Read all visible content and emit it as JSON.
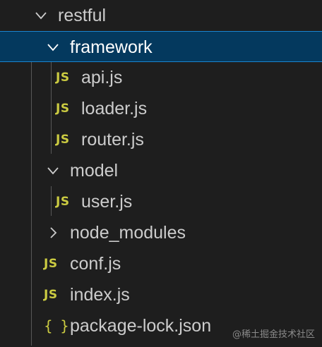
{
  "tree": {
    "root": {
      "label": "restful",
      "icon": "chevron-down-icon"
    },
    "framework": {
      "label": "framework",
      "icon": "chevron-down-icon"
    },
    "framework_files": [
      {
        "label": "api.js",
        "badge": "JS"
      },
      {
        "label": "loader.js",
        "badge": "JS"
      },
      {
        "label": "router.js",
        "badge": "JS"
      }
    ],
    "model": {
      "label": "model",
      "icon": "chevron-down-icon"
    },
    "model_files": [
      {
        "label": "user.js",
        "badge": "JS"
      }
    ],
    "node_modules": {
      "label": "node_modules",
      "icon": "chevron-right-icon"
    },
    "root_files": [
      {
        "label": "conf.js",
        "badge": "JS"
      },
      {
        "label": "index.js",
        "badge": "JS"
      },
      {
        "label": "package-lock.json",
        "badge": "{ }"
      }
    ]
  },
  "watermark": "@稀土掘金技术社区",
  "colors": {
    "background": "#1e1e1e",
    "selected_bg": "#04395e",
    "selected_border": "#1a85d0",
    "js_icon": "#cbcb41",
    "text": "#cccccc"
  }
}
